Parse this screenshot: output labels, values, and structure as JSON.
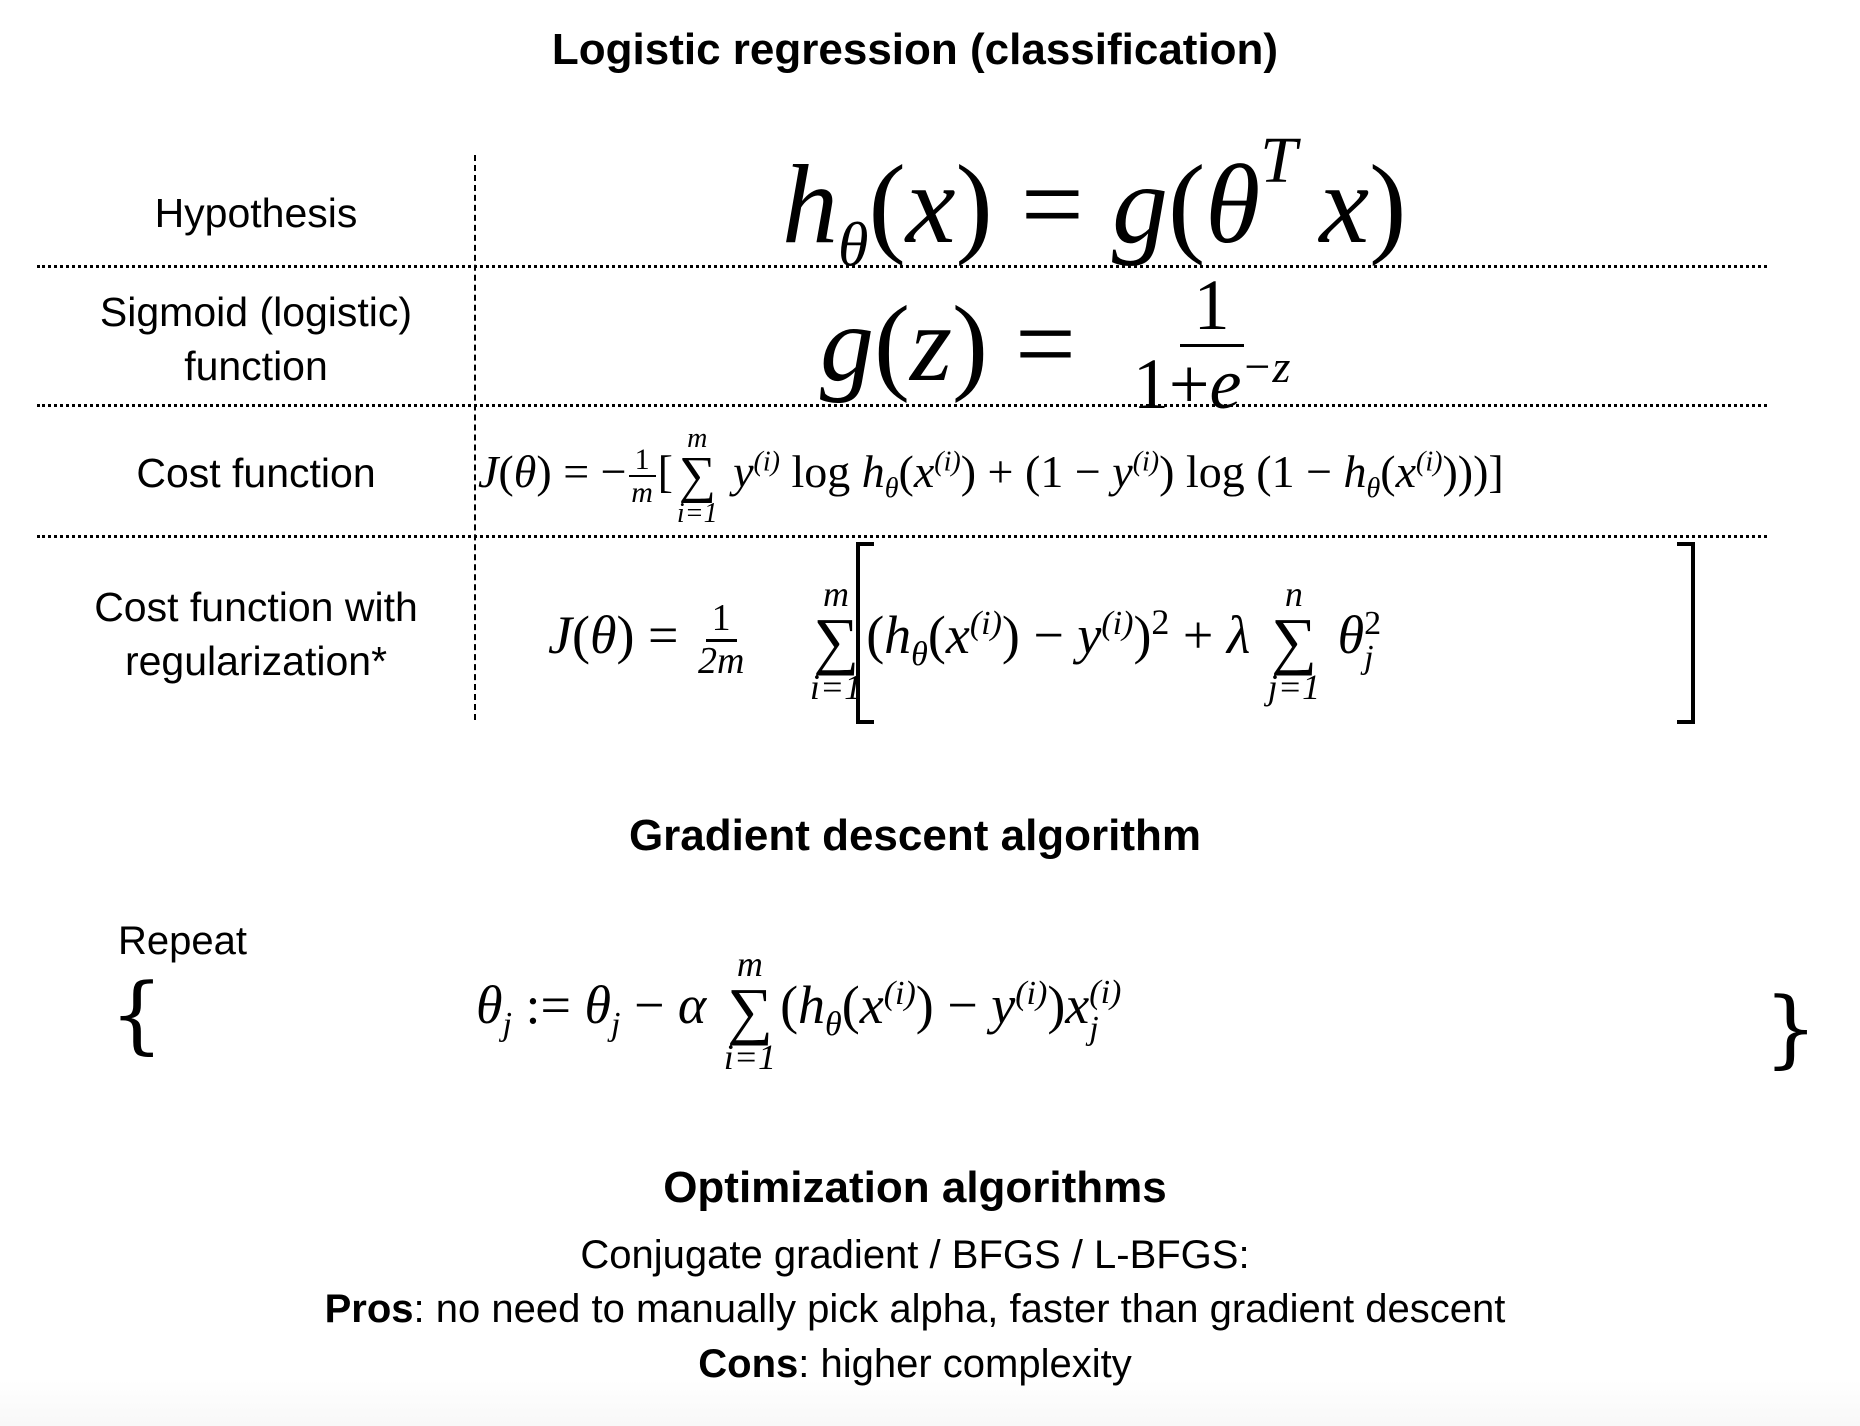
{
  "title": "Logistic regression (classification)",
  "table": {
    "rows": [
      {
        "label_lines": [
          "Hypothesis"
        ],
        "formula": {
          "lhs": "h",
          "lhs_sub": "θ",
          "arg": "x",
          "eq": "=",
          "rhs_fn": "g",
          "rhs_theta": "θ",
          "rhs_sup": "T",
          "rhs_x": "x",
          "latex": "h_\\theta(x) = g(\\theta^T x)"
        }
      },
      {
        "label_lines": [
          "Sigmoid (logistic)",
          "function"
        ],
        "formula": {
          "lhs_fn": "g",
          "arg": "z",
          "eq": "=",
          "numerator": "1",
          "den_one": "1",
          "den_plus": "+",
          "den_e": "e",
          "den_exp": "−z",
          "latex": "g(z) = \\frac{1}{1+e^{-z}}"
        }
      },
      {
        "label_lines": [
          "Cost function"
        ],
        "formula": {
          "latex": "J(\\theta) = -\\frac{1}{m}[\\sum_{i=1}^{m} y^{(i)} \\log h_\\theta(x^{(i)}) + (1 - y^{(i)}) \\log (1 - h_\\theta(x^{(i)}))]",
          "J": "J",
          "theta": "θ",
          "eq": "=",
          "minus": "−",
          "frac_num": "1",
          "frac_den": "m",
          "sum_upper": "m",
          "sum_lower": "i=1",
          "sigma": "∑",
          "y": "y",
          "sup_i": "(i)",
          "log": "log",
          "h": "h",
          "x": "x",
          "plus": "+",
          "one": "1"
        }
      },
      {
        "label_lines": [
          "Cost function with",
          "regularization*"
        ],
        "formula": {
          "latex": "J(\\theta) = \\frac{1}{2m}\\left[\\sum_{i=1}^{m}(h_\\theta(x^{(i)}) - y^{(i)})^2 + \\lambda \\sum_{j=1}^{n} \\theta_j^2\\right]",
          "J": "J",
          "theta": "θ",
          "eq": "=",
          "frac_num": "1",
          "frac_den": "2m",
          "sum1_upper": "m",
          "sum1_lower": "i=1",
          "sum2_upper": "n",
          "sum2_lower": "j=1",
          "sigma": "∑",
          "h": "h",
          "x": "x",
          "y": "y",
          "sup_i": "(i)",
          "sq": "2",
          "minus": "−",
          "plus": "+",
          "lambda": "λ",
          "sub_j": "j"
        }
      }
    ]
  },
  "gradient_descent": {
    "heading": "Gradient descent algorithm",
    "repeat_label": "Repeat",
    "open_brace": "{",
    "close_brace": "}",
    "formula": {
      "latex": "\\theta_j := \\theta_j - \\alpha \\sum_{i=1}^{m}(h_\\theta(x^{(i)}) - y^{(i)})x_j^{(i)}",
      "theta": "θ",
      "sub_j": "j",
      "assign": ":=",
      "minus": "−",
      "alpha": "α",
      "sigma": "∑",
      "sum_upper": "m",
      "sum_lower": "i=1",
      "h": "h",
      "x": "x",
      "y": "y",
      "sup_i": "(i)"
    }
  },
  "optimization": {
    "heading": "Optimization algorithms",
    "methods_line": "Conjugate gradient / BFGS / L-BFGS:",
    "pros_label": "Pros",
    "pros_text": ": no need to manually pick alpha, faster than gradient descent",
    "cons_label": "Cons",
    "cons_text": ": higher complexity"
  }
}
